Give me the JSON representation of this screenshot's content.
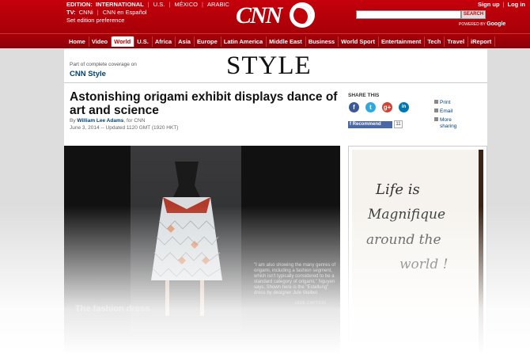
{
  "header": {
    "edition_label": "EDITION:",
    "edition_items": [
      "INTERNATIONAL",
      "U.S.",
      "MÉXICO",
      "ARABIC"
    ],
    "tv_label": "TV:",
    "tv_items": [
      "CNNi",
      "CNN en Español"
    ],
    "set_edition": "Set edition preference",
    "logo": "CNN",
    "sign_up": "Sign up",
    "log_in": "Log in",
    "search_button": "SEARCH",
    "powered_by": "POWERED BY",
    "google": "Google"
  },
  "nav": {
    "items": [
      "Home",
      "Video",
      "World",
      "U.S.",
      "Africa",
      "Asia",
      "Europe",
      "Latin America",
      "Middle East",
      "Business",
      "World Sport",
      "Entertainment",
      "Tech",
      "Travel",
      "iReport"
    ],
    "active": "World"
  },
  "section": {
    "part_of": "Part of complete coverage on",
    "cnn_style": "CNN Style",
    "logo": "STYLE"
  },
  "article": {
    "title": "Astonishing origami exhibit displays dance of art and science",
    "by": "By",
    "author": "William Lee Adams",
    "for": ", for CNN",
    "date": "June 3, 2014 -- Updated 1120 GMT (1920 HKT)"
  },
  "share": {
    "label": "SHARE THIS",
    "recommend": "Recommend",
    "recommend_count": "11",
    "print": "Print",
    "email": "Email",
    "more_sharing": "More sharing"
  },
  "gallery": {
    "caption": "\"I am also showing the many genres of origami, including a fashion segment, which isn't typically considered to be a standard category of origami,\" Nguyen says. Shown here is the \"Estallung\" dress by designer Jule Waibel.",
    "hide_caption": "HIDE CAPTION",
    "title": "The fashion dress"
  },
  "ad": {
    "line1": "Life is",
    "line2": "Magnifique",
    "line3": "around the",
    "line4": "world !"
  },
  "colors": {
    "cnn_red": "#c4000b",
    "link_blue": "#004276"
  }
}
